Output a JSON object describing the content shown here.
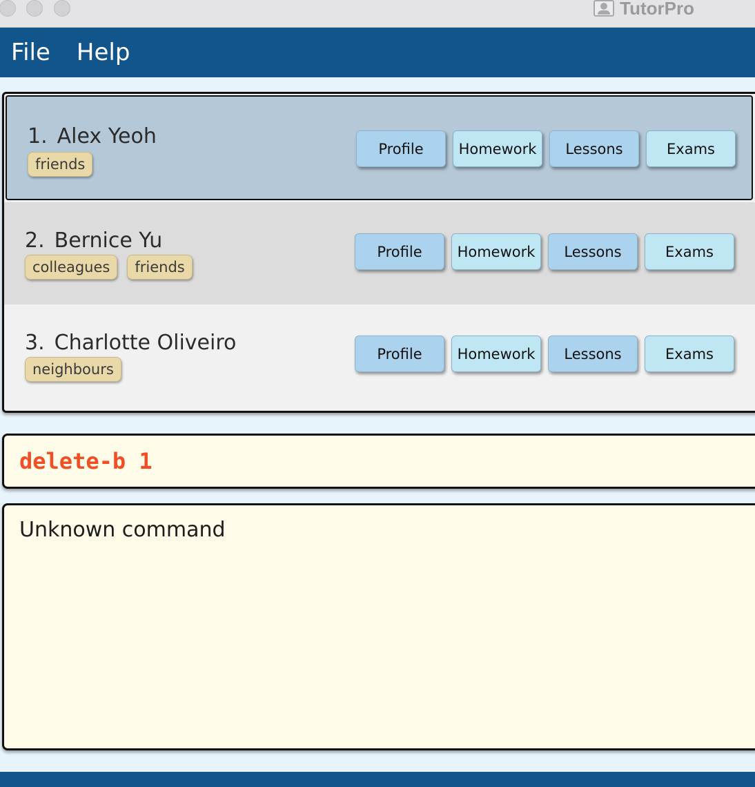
{
  "window": {
    "title": "TutorPro"
  },
  "menu": {
    "items": [
      {
        "label": "File"
      },
      {
        "label": "Help"
      }
    ]
  },
  "persons": [
    {
      "index": "1.",
      "name": "Alex Yeoh",
      "tags": [
        "friends"
      ],
      "selected": true
    },
    {
      "index": "2.",
      "name": "Bernice Yu",
      "tags": [
        "colleagues",
        "friends"
      ],
      "selected": false
    },
    {
      "index": "3.",
      "name": "Charlotte Oliveiro",
      "tags": [
        "neighbours"
      ],
      "selected": false
    }
  ],
  "buttons": {
    "profile": "Profile",
    "homework": "Homework",
    "lessons": "Lessons",
    "exams": "Exams"
  },
  "command": {
    "value": "delete-b 1"
  },
  "result": {
    "text": "Unknown command"
  },
  "colors": {
    "menubar": "#12558a",
    "selected_card": "#b4c8d8",
    "command_text": "#f04e25",
    "tag_bg": "#ead9a8"
  }
}
